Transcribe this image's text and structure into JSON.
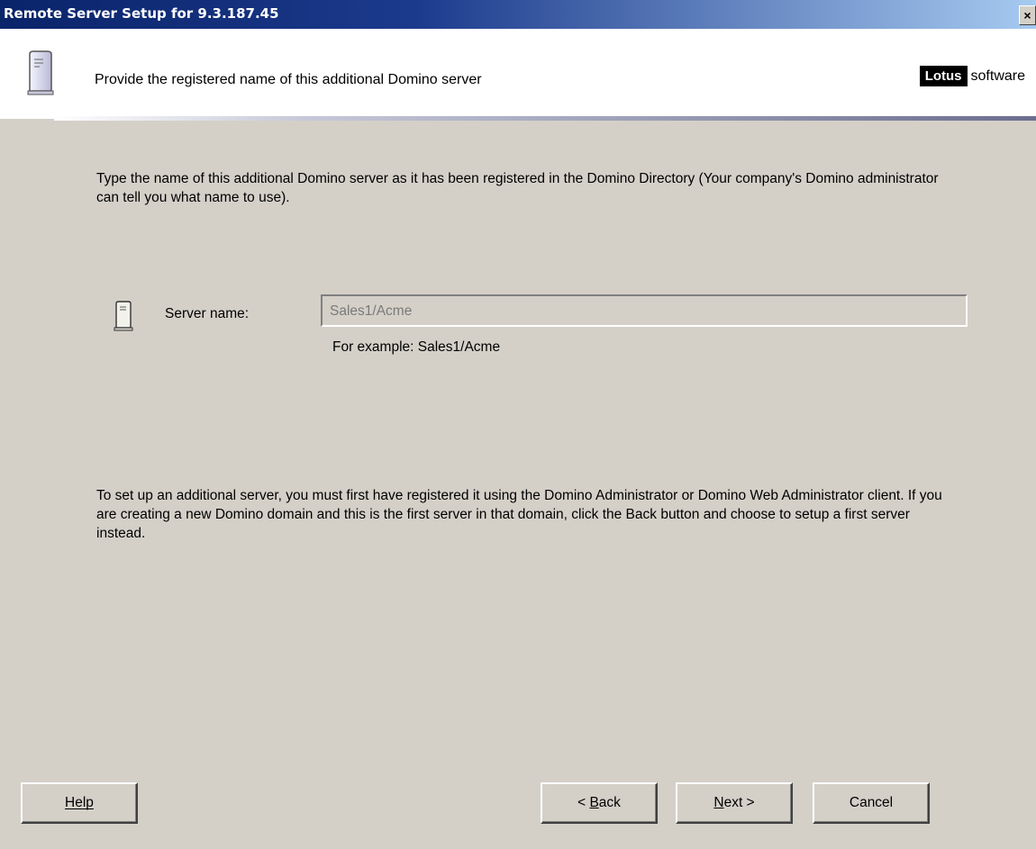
{
  "window": {
    "title": "Remote Server Setup for 9.3.187.45",
    "close_label": "×"
  },
  "header": {
    "text": "Provide the registered name of this additional Domino server",
    "logo_dark": "Lotus",
    "logo_light": "software"
  },
  "main": {
    "intro": "Type the name of this additional Domino server as it has been registered in the Domino Directory (Your company's Domino administrator can tell you what name to use).",
    "server_label": "Server name:",
    "server_value": "Sales1/Acme",
    "example": "For example: Sales1/Acme",
    "note": "To set up an additional server, you must first have registered it using the Domino Administrator or Domino Web Administrator client. If you are creating a new Domino domain and this is the first server in that domain, click the Back button and choose to setup a first server instead."
  },
  "buttons": {
    "help": "Help",
    "back_prefix": "< ",
    "back_u": "B",
    "back_rest": "ack",
    "next_u": "N",
    "next_rest": "ext >",
    "cancel": "Cancel"
  }
}
